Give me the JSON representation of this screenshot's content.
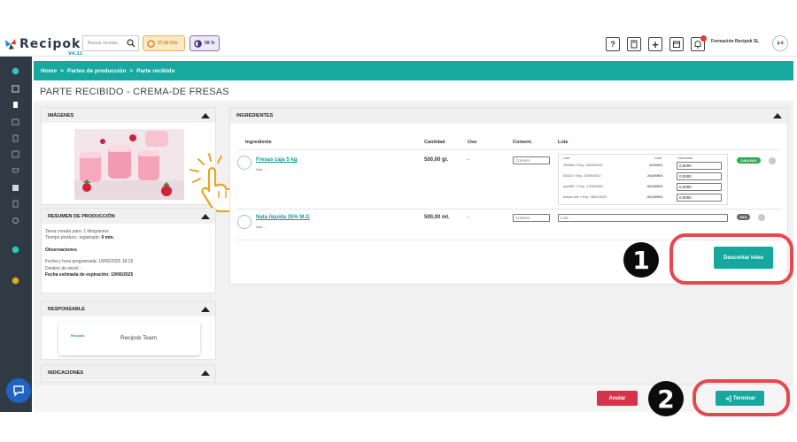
{
  "app": {
    "name": "Recipok",
    "version": "V4.11",
    "search_placeholder": "Buscar recetas..",
    "credits": "37,50 €/hr",
    "progress": "58 %",
    "company": "Formación Recipok SL"
  },
  "breadcrumb": {
    "home": "Home",
    "sep1": ">",
    "section": "Partes de producción",
    "sep2": ">",
    "current": "Parte recibido"
  },
  "page_title": "PARTE RECIBIDO - CREMA-DE FRESAS",
  "panels": {
    "images_title": "IMÁGENES",
    "summary_title": "RESUMEN DE PRODUCCIÓN",
    "summary": {
      "line1": "Tarea creada para: 1 kilogramos",
      "line2_label": "Tiempo producc. registrado: ",
      "line2_value": "0 min.",
      "obs_label": "Observaciones",
      "line3": "Fecha y hora programada: 18/06/2025 18:15",
      "line4": "Destino de stock: -",
      "line5": "Fecha estimada de expiración: 19/06/2025"
    },
    "responsible_title": "RESPONSABLE",
    "responsible_name": "Recipok Team",
    "responsible_logo": "Recipok",
    "indications_title": "INDICACIONES"
  },
  "ingredients": {
    "title": "INGREDIENTES",
    "columns": [
      "Ingrediente",
      "Cantidad",
      "Uso",
      "Coment.",
      "Lote"
    ],
    "items": [
      {
        "name": "Fresas caja 5 kg",
        "sub": "Uso: -",
        "qty": "500,00 gr.",
        "use": "-",
        "comment_placeholder": "Coment.",
        "lot_headers": [
          "Lote",
          "Cant.",
          "Descontar"
        ],
        "lots": [
          {
            "lot": "254383 // Exp. 26/05/2022",
            "qty": "4,020KG",
            "discount": "0,5000"
          },
          {
            "lot": "54324 // Exp. 25/05/2022",
            "qty": "24,000KG",
            "discount": "0,0000"
          },
          {
            "lot": "acyt457 // Exp. 17/06/2022",
            "qty": "60,000KG",
            "discount": "0,0000"
          },
          {
            "lot": "fresas-lote // Exp. 08/11/2022",
            "qty": "60,000KG",
            "discount": "0,0000"
          }
        ],
        "badge": "148,03KG"
      },
      {
        "name": "Nata líquida 35% M.G",
        "sub": "Uso: -",
        "qty": "500,00 ml.",
        "use": "-",
        "comment_placeholder": "Coment.",
        "lot_placeholder": "Lote",
        "badge": "0KG"
      }
    ],
    "discount_button": "Descontar lotes"
  },
  "footer": {
    "cancel": "Anular",
    "finish": "Terminar"
  },
  "annotations": {
    "step1": "1",
    "step2": "2"
  },
  "colors": {
    "teal": "#16a89f",
    "red": "#d6334a",
    "sidebar": "#2f3a44",
    "callout": "#e5484d"
  }
}
